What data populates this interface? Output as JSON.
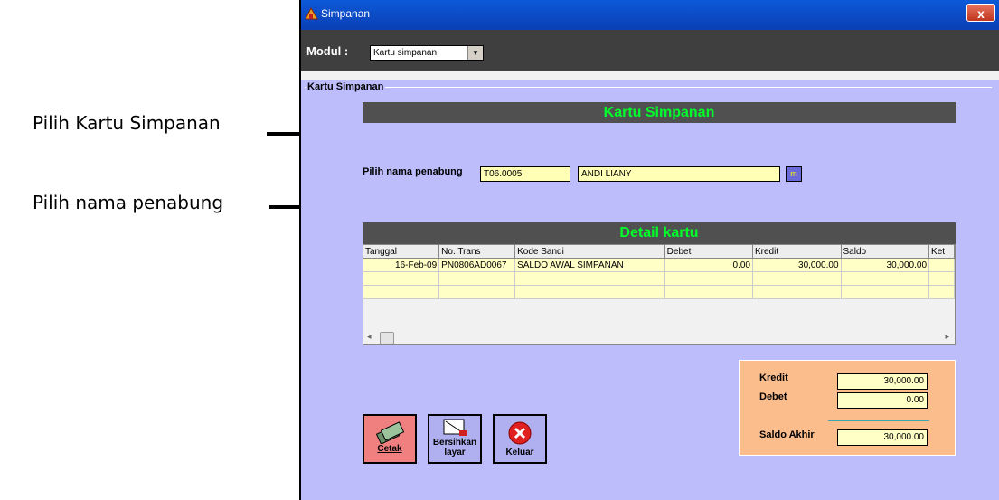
{
  "annotations": {
    "label_1": "Pilih Kartu Simpanan",
    "label_2": "Pilih nama penabung"
  },
  "window": {
    "title": "Simpanan",
    "close_glyph": "x"
  },
  "toolbar": {
    "modul_label": "Modul :",
    "modul_value": "Kartu simpanan"
  },
  "group": {
    "legend": "Kartu Simpanan"
  },
  "header_bar": "Kartu Simpanan",
  "penabung": {
    "label": "Pilih nama penabung",
    "code": "T06.0005",
    "name": "ANDI LIANY",
    "lookup_glyph": "m"
  },
  "detail_bar": "Detail kartu",
  "table": {
    "columns": [
      "Tanggal",
      "No. Trans",
      "Kode Sandi",
      "Debet",
      "Kredit",
      "Saldo",
      "Ket"
    ],
    "rows": [
      [
        "16-Feb-09",
        "PN0806AD0067",
        "SALDO AWAL SIMPANAN",
        "0.00",
        "30,000.00",
        "30,000.00",
        ""
      ]
    ]
  },
  "summary": {
    "kredit_label": "Kredit",
    "kredit_value": "30,000.00",
    "debet_label": "Debet",
    "debet_value": "0.00",
    "saldo_label": "Saldo Akhir",
    "saldo_value": "30,000.00"
  },
  "buttons": {
    "cetak": "Cetak",
    "bersihkan": "Bersihkan layar",
    "keluar": "Keluar"
  },
  "colors": {
    "form_bg": "#bdbdfb",
    "title_green": "#00ff2a",
    "field_yellow": "#ffffb6",
    "summary_orange": "#fbbd8c"
  }
}
